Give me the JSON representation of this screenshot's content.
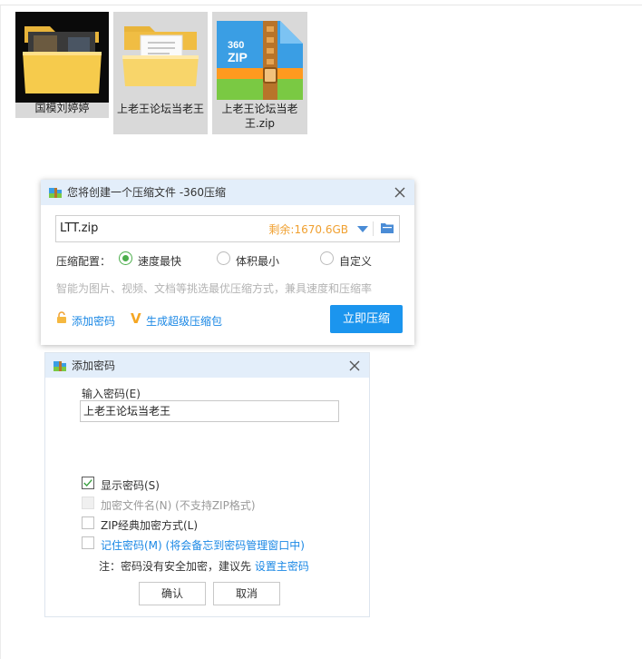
{
  "files": [
    {
      "name": "国模刘婷婷",
      "type": "folder-with-image"
    },
    {
      "name": "上老王论坛当老王",
      "type": "folder-document"
    },
    {
      "name": "上老王论坛当老王.zip",
      "type": "zip-archive"
    }
  ],
  "zip_icon_text": "360 ZIP",
  "compress_dialog": {
    "title": "您将创建一个压缩文件 -360压缩",
    "filename": "LTT.zip",
    "space_remaining": "剩余:1670.6GB",
    "config_label": "压缩配置：",
    "options": [
      "速度最快",
      "体积最小",
      "自定义"
    ],
    "selected_option": "速度最快",
    "hint": "智能为图片、视频、文档等挑选最优压缩方式，兼具速度和压缩率",
    "add_password": "添加密码",
    "super_package": "生成超级压缩包",
    "compress_button": "立即压缩"
  },
  "password_dialog": {
    "title": "添加密码",
    "input_label": "输入密码(E)",
    "password_value": "上老王论坛当老王",
    "checkboxes": [
      {
        "label": "显示密码(S)",
        "checked": true,
        "disabled": false
      },
      {
        "label": "加密文件名(N) (不支持ZIP格式)",
        "checked": false,
        "disabled": true
      },
      {
        "label": "ZIP经典加密方式(L)",
        "checked": false,
        "disabled": false
      },
      {
        "label": "记住密码(M) (将会备忘到密码管理窗口中)",
        "checked": false,
        "disabled": false
      }
    ],
    "note_prefix": "注：密码没有安全加密，建议先 ",
    "note_link": "设置主密码",
    "ok_button": "确认",
    "cancel_button": "取消"
  },
  "colors": {
    "accent": "#1b95ee",
    "link": "#1b88e5",
    "title_bar": "#e3eefa",
    "space_text": "#f0a030",
    "radio_selected": "#4cae4c"
  }
}
